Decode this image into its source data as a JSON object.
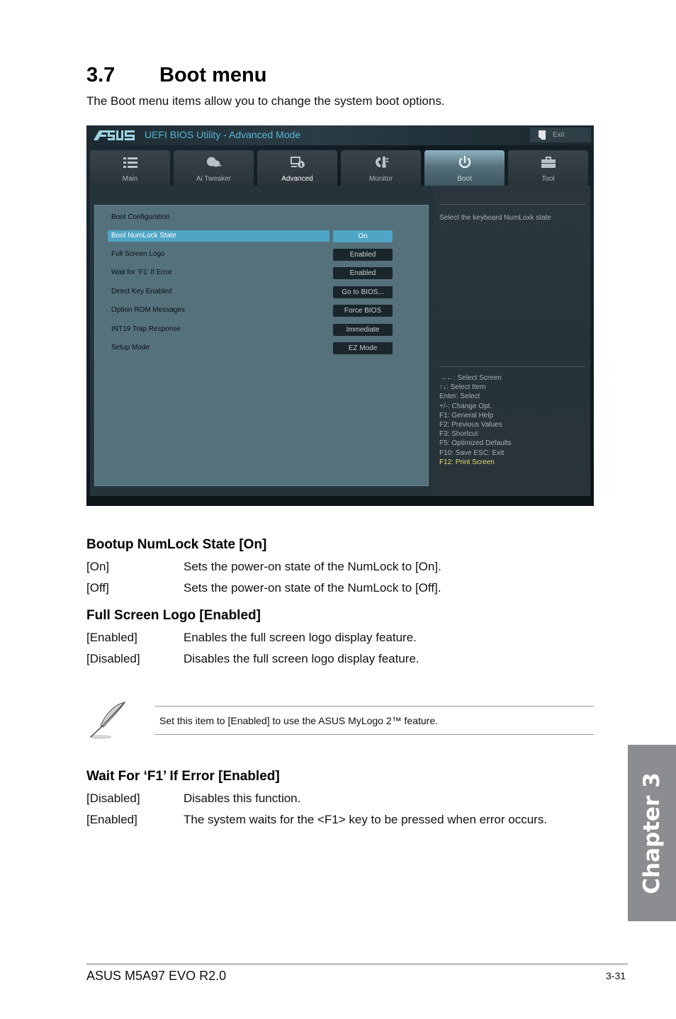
{
  "section": {
    "number": "3.7",
    "title": "Boot menu",
    "intro": "The Boot menu items allow you to change the system boot options."
  },
  "bios": {
    "brand": "ASUS",
    "title": "UEFI BIOS Utility - Advanced Mode",
    "exit_label": "Exit",
    "colors": {
      "accent": "#4fa5c6",
      "title": "#56b6d4",
      "help_accent": "#e7df7a"
    },
    "tabs": [
      {
        "label": "Main",
        "icon": "list-icon"
      },
      {
        "label": "Ai  Tweaker",
        "icon": "tweaker-icon"
      },
      {
        "label": "Advanced",
        "icon": "advanced-icon"
      },
      {
        "label": "Monitor",
        "icon": "monitor-icon"
      },
      {
        "label": "Boot",
        "icon": "power-icon",
        "active": true
      },
      {
        "label": "Tool",
        "icon": "toolbox-icon"
      }
    ],
    "panel_heading": "Boot Configuration",
    "items": [
      {
        "label": "Boot NumLock State",
        "value": "On",
        "selected": true
      },
      {
        "label": "Full Screen Logo",
        "value": "Enabled"
      },
      {
        "label": "Wait for ‘F1’ If Error",
        "value": "Enabled"
      },
      {
        "label": "Direct Key Enabled",
        "value": "Go to BIOS..."
      },
      {
        "label": "Option ROM Messages",
        "value": "Force BIOS"
      },
      {
        "label": "INT19 Trap Response",
        "value": "Immediate"
      },
      {
        "label": "Setup Mode",
        "value": "EZ Mode"
      }
    ],
    "help_text": "Select the keyboard NumLoxk state",
    "keys": [
      "→←:  Select Screen",
      "↑↓:  Select Item",
      "Enter:  Select",
      "+/-:  Change Opt.",
      "F1:  General Help",
      "F2:  Previous Values",
      "F3:  Shortcut",
      "F5:  Optimized Defaults",
      "F10:  Save    ESC:  Exit",
      "F12: Print Screen"
    ]
  },
  "descriptions": [
    {
      "heading": "Bootup NumLock State [On]",
      "options": [
        {
          "option": "[On]",
          "text": "Sets the power-on state of the NumLock to [On]."
        },
        {
          "option": "[Off]",
          "text": "Sets the power-on state of the NumLock to [Off]."
        }
      ]
    },
    {
      "heading": "Full Screen Logo [Enabled]",
      "options": [
        {
          "option": "[Enabled]",
          "text": "Enables the full screen logo display feature."
        },
        {
          "option": "[Disabled]",
          "text": "Disables the full screen logo display feature."
        }
      ]
    },
    {
      "heading": "Wait For ‘F1’ If Error [Enabled]",
      "options": [
        {
          "option": "[Disabled]",
          "text": "Disables this function."
        },
        {
          "option": "[Enabled]",
          "text": "The system waits for the <F1> key to be pressed when error occurs."
        }
      ]
    }
  ],
  "note": {
    "icon": "quill-pen-icon",
    "text": "Set this item to [Enabled] to use the ASUS MyLogo 2™ feature."
  },
  "chapter_tab": "Chapter 3",
  "footer": {
    "product": "ASUS M5A97 EVO R2.0",
    "page": "3-31"
  }
}
